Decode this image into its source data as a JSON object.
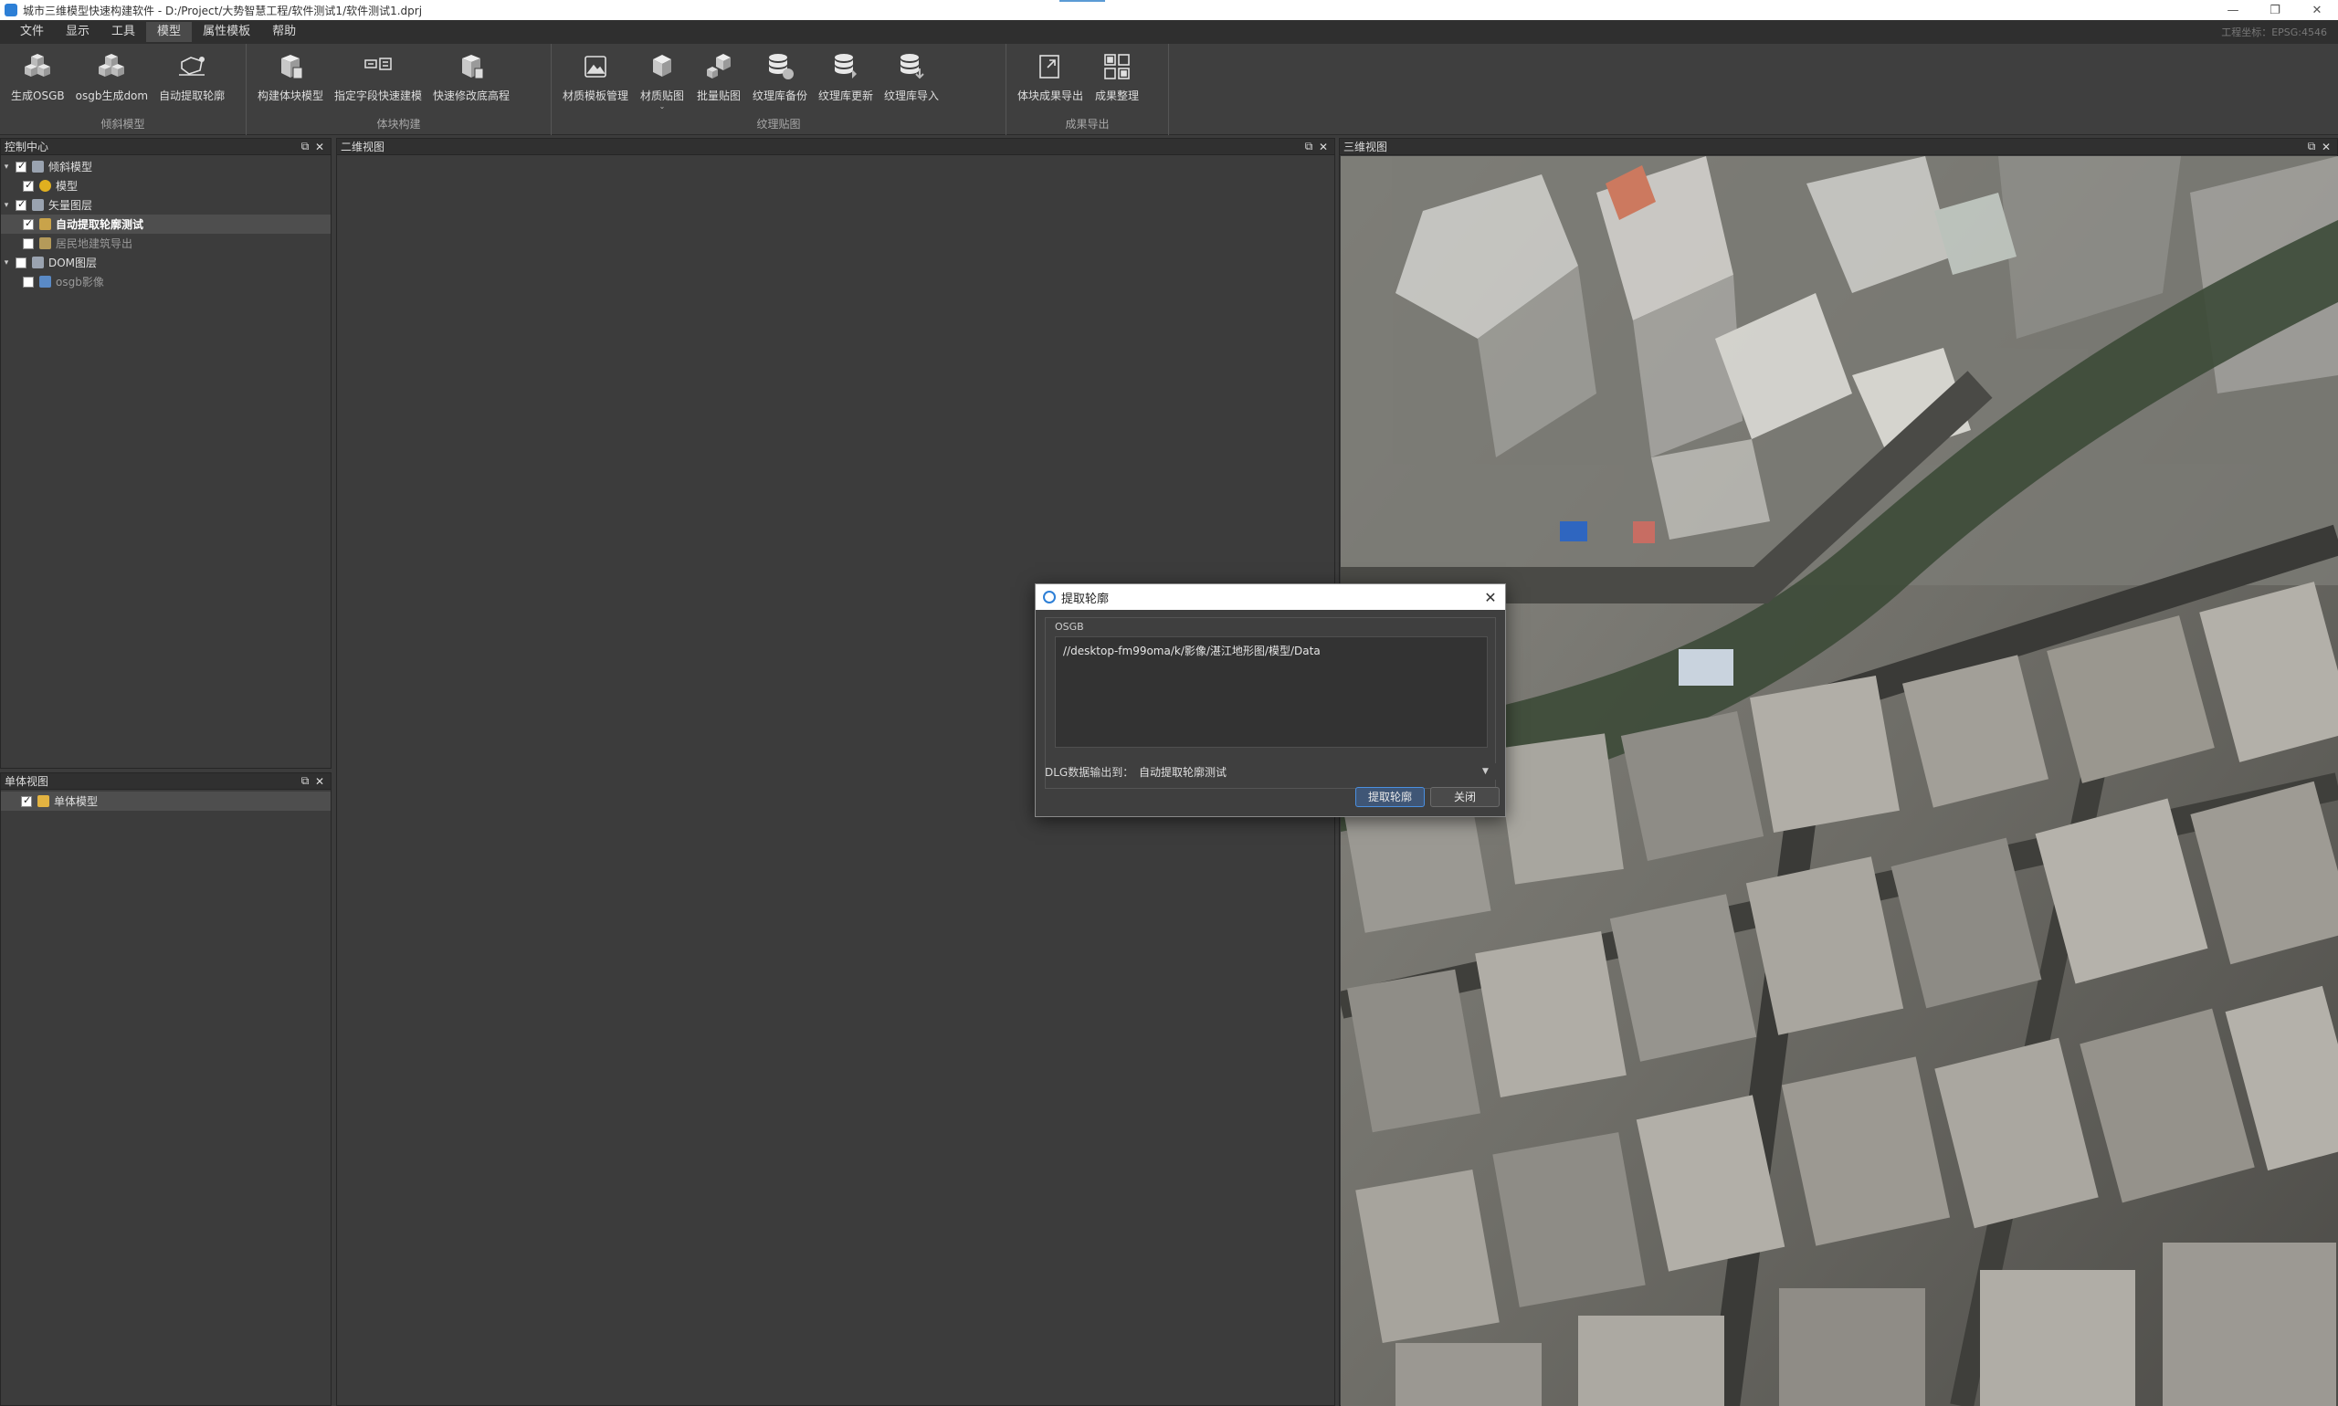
{
  "titlebar": {
    "title": "城市三维模型快速构建软件 - D:/Project/大势智慧工程/软件测试1/软件测试1.dprj",
    "minimize_icon": "minimize-icon",
    "maximize_icon": "restore-icon",
    "close_icon": "close-icon"
  },
  "menubar": {
    "items": [
      {
        "label": "文件"
      },
      {
        "label": "显示"
      },
      {
        "label": "工具"
      },
      {
        "label": "模型",
        "active": true
      },
      {
        "label": "属性模板"
      },
      {
        "label": "帮助"
      }
    ],
    "coordinate": "工程坐标：EPSG:4546"
  },
  "ribbon": {
    "groups": [
      {
        "label": "倾斜模型",
        "buttons": [
          {
            "label": "生成OSGB",
            "icon": "osgb-cubes-icon"
          },
          {
            "label": "osgb生成dom",
            "icon": "osgb-dom-icon"
          },
          {
            "label": "自动提取轮廓",
            "icon": "extract-outline-icon"
          }
        ]
      },
      {
        "label": "体块构建",
        "buttons": [
          {
            "label": "构建体块模型",
            "icon": "build-block-icon"
          },
          {
            "label": "指定字段快速建模",
            "icon": "field-model-icon"
          },
          {
            "label": "快速修改底高程",
            "icon": "elevation-icon"
          }
        ]
      },
      {
        "label": "纹理贴图",
        "buttons": [
          {
            "label": "材质模板管理",
            "icon": "material-template-icon"
          },
          {
            "label": "材质贴图",
            "icon": "material-map-icon",
            "caret": "⌄"
          },
          {
            "label": "批量贴图",
            "icon": "batch-map-icon"
          },
          {
            "label": "纹理库备份",
            "icon": "texture-backup-icon"
          },
          {
            "label": "纹理库更新",
            "icon": "texture-update-icon"
          },
          {
            "label": "纹理库导入",
            "icon": "texture-import-icon"
          }
        ]
      },
      {
        "label": "成果导出",
        "buttons": [
          {
            "label": "体块成果导出",
            "icon": "export-icon"
          },
          {
            "label": "成果整理",
            "icon": "organize-icon"
          }
        ]
      }
    ]
  },
  "control_center": {
    "title": "控制中心",
    "tree": [
      {
        "label": "倾斜模型",
        "level": 0,
        "checked": true,
        "expanded": true,
        "icon": "layer-icon"
      },
      {
        "label": "模型",
        "level": 1,
        "checked": true,
        "icon": "model-icon"
      },
      {
        "label": "矢量图层",
        "level": 0,
        "checked": true,
        "expanded": true,
        "icon": "layer-icon"
      },
      {
        "label": "自动提取轮廓测试",
        "level": 1,
        "checked": true,
        "icon": "vector-icon",
        "selected": true
      },
      {
        "label": "居民地建筑导出",
        "level": 1,
        "checked": false,
        "icon": "vector-icon",
        "dim": true
      },
      {
        "label": "DOM图层",
        "level": 0,
        "checked": false,
        "expanded": true,
        "icon": "layer-icon"
      },
      {
        "label": "osgb影像",
        "level": 1,
        "checked": false,
        "icon": "image-icon",
        "dim": true
      }
    ]
  },
  "single_view": {
    "title": "单体视图",
    "items": [
      {
        "label": "单体模型",
        "checked": true
      }
    ]
  },
  "view_2d": {
    "title": "二维视图"
  },
  "view_3d": {
    "title": "三维视图"
  },
  "panel_buttons": {
    "float": "⧉",
    "close": "✕"
  },
  "dialog": {
    "title": "提取轮廓",
    "group_label": "OSGB",
    "path": "//desktop-fm99oma/k/影像/湛江地形图/模型/Data",
    "output_label": "DLG数据输出到：",
    "output_value": "自动提取轮廓测试",
    "extract_button": "提取轮廓",
    "close_button": "关闭",
    "close_glyph": "✕"
  },
  "colors": {
    "background": "#3c3c3c",
    "header": "#303030",
    "accent": "#2d7fd6",
    "selected_row": "#4e4e4e"
  }
}
